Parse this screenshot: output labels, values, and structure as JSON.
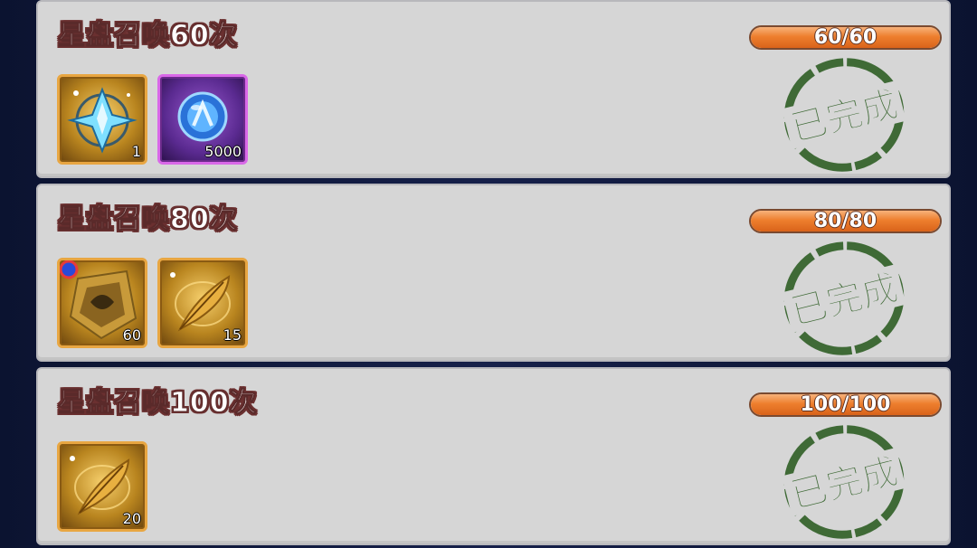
{
  "tasks": [
    {
      "title": "星盘召唤60次",
      "progress_text": "60/60",
      "progress_fraction": 1.0,
      "status_stamp": "已完成",
      "rewards": [
        {
          "icon": "star-compass-icon",
          "frame": "gold",
          "count": "1"
        },
        {
          "icon": "blue-crystal-orb-icon",
          "frame": "purple",
          "count": "5000"
        }
      ]
    },
    {
      "title": "星盘召唤80次",
      "progress_text": "80/80",
      "progress_fraction": 1.0,
      "status_stamp": "已完成",
      "rewards": [
        {
          "icon": "golden-hero-shard-icon",
          "frame": "gold",
          "count": "60"
        },
        {
          "icon": "golden-feather-icon",
          "frame": "gold",
          "count": "15"
        }
      ]
    },
    {
      "title": "星盘召唤100次",
      "progress_text": "100/100",
      "progress_fraction": 1.0,
      "status_stamp": "已完成",
      "rewards": [
        {
          "icon": "golden-feather-icon",
          "frame": "gold",
          "count": "20"
        }
      ]
    }
  ],
  "colors": {
    "card_bg": "#d6d6d6",
    "progress_fill": "#ee7f2e",
    "stamp_green": "#3f6a36",
    "gold_frame": "#e8a642",
    "purple_frame": "#d968e8"
  }
}
